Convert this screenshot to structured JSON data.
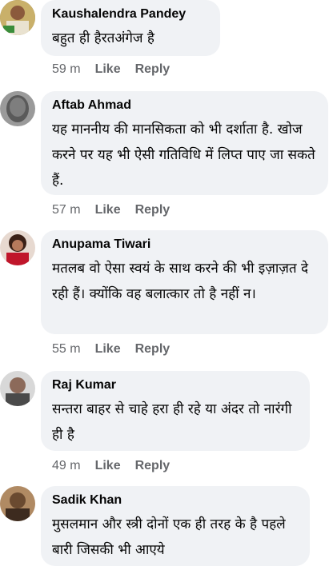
{
  "comments": [
    {
      "author": "Kaushalendra Pandey",
      "text": "बहुत ही हैरतअंगेज है",
      "time": "59 m",
      "like": "Like",
      "reply": "Reply"
    },
    {
      "author": "Aftab Ahmad",
      "text": "यह माननीय की मानसिकता को भी दर्शाता है. खोज करने पर यह भी ऐसी गतिविधि में लिप्त पाए जा सकते हैं.",
      "time": "57 m",
      "like": "Like",
      "reply": "Reply"
    },
    {
      "author": "Anupama Tiwari",
      "text": "मतलब वो ऐसा स्वयं के साथ करने की भी इज़ाज़त दे रही हैं। क्योंकि वह बलात्कार तो है नहीं न।",
      "time": "55 m",
      "like": "Like",
      "reply": "Reply"
    },
    {
      "author": "Raj Kumar",
      "text": "सन्तरा बाहर से चाहे हरा ही रहे या अंदर तो नारंगी ही है",
      "time": "49 m",
      "like": "Like",
      "reply": "Reply"
    },
    {
      "author": "Sadik Khan",
      "text": "मुसलमान और स्त्री दोनों एक ही तरह के है पहले बारी जिसकी भी आएये",
      "time": "",
      "like": "",
      "reply": ""
    }
  ]
}
